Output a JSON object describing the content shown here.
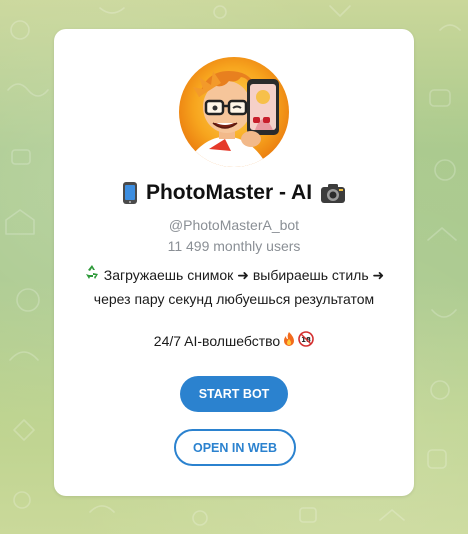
{
  "bot": {
    "name": "PhotoMaster - AI",
    "username": "@PhotoMasterA_bot",
    "monthly_users": "11 499 monthly users"
  },
  "description": {
    "line1": "Загружаешь снимок ➜ выбираешь стиль ➜",
    "line2": "через пару секунд любуешься результатом",
    "tagline": "24/7 AI-волшебство"
  },
  "buttons": {
    "start_label": "START BOT",
    "open_web_label": "OPEN IN WEB"
  },
  "colors": {
    "accent": "#2b82cf",
    "card": "#ffffff",
    "muted_text": "#8a8f95",
    "background_green": "#a9c98c"
  },
  "icons": {
    "title_left": "mobile-phone-icon",
    "title_right": "camera-icon",
    "description_left": "recycle-icon",
    "tagline_fire": "fire-icon",
    "tagline_age": "no-under-18-icon"
  }
}
